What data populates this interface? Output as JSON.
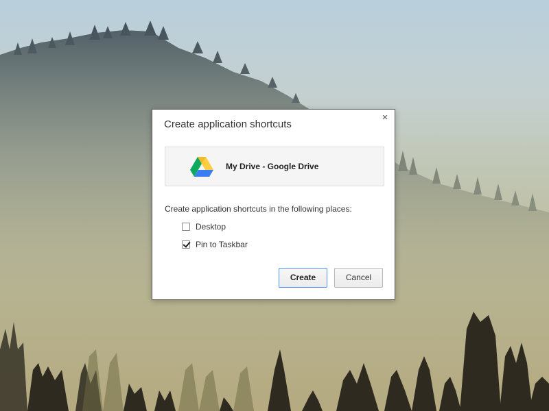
{
  "dialog": {
    "title": "Create application shortcuts",
    "close_glyph": "×",
    "app": {
      "name": "My Drive - Google Drive",
      "icon": "google-drive-icon"
    },
    "places_label": "Create application shortcuts in the following places:",
    "options": [
      {
        "label": "Desktop",
        "checked": false
      },
      {
        "label": "Pin to Taskbar",
        "checked": true
      }
    ],
    "buttons": {
      "create_label": "Create",
      "cancel_label": "Cancel"
    }
  },
  "colors": {
    "focus_border": "#4d90fe",
    "drive_green": "#0da960",
    "drive_yellow": "#ffcd40",
    "drive_blue": "#3a7cf4"
  }
}
